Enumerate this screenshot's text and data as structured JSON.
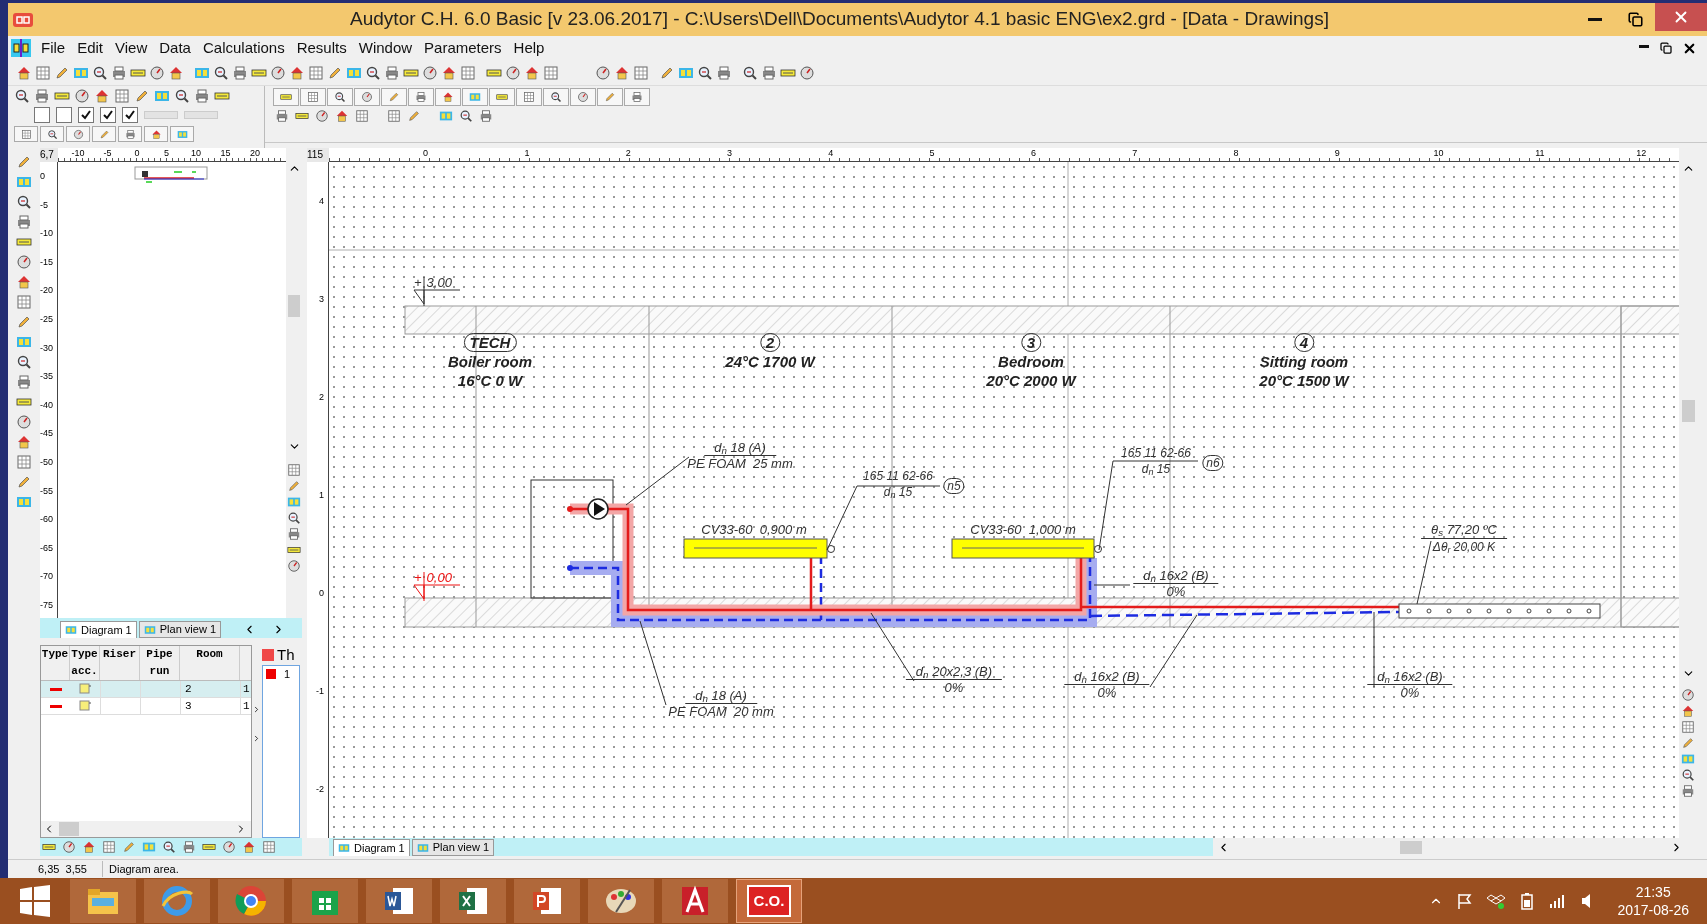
{
  "window": {
    "title": "Audytor C.H. 6.0 Basic [v 23.06.2017] - C:\\Users\\Dell\\Documents\\Audytor 4.1 basic ENG\\ex2.grd - [Data - Drawings]"
  },
  "menu": [
    "File",
    "Edit",
    "View",
    "Data",
    "Calculations",
    "Results",
    "Window",
    "Parameters",
    "Help"
  ],
  "toolbar_checkboxes": [
    {
      "checked": false
    },
    {
      "checked": false
    },
    {
      "checked": true
    },
    {
      "checked": true
    },
    {
      "checked": true
    }
  ],
  "overview": {
    "corner": "6,7",
    "x_ruler": [
      "-10",
      "-5",
      "0",
      "5",
      "10",
      "15",
      "20"
    ],
    "y_ruler": [
      "0",
      "-5",
      "-10",
      "-15",
      "-20",
      "-25",
      "-30",
      "-35",
      "-40",
      "-45",
      "-50",
      "-55",
      "-60",
      "-65",
      "-70",
      "-75"
    ],
    "tabs": [
      {
        "label": "Diagram 1",
        "selected": true
      },
      {
        "label": "Plan view 1",
        "selected": false
      }
    ]
  },
  "table": {
    "columns": [
      [
        "Type"
      ],
      [
        "Type",
        "acc."
      ],
      [
        "Riser"
      ],
      [
        "Pipe",
        "run"
      ],
      [
        "Room"
      ]
    ],
    "rows": [
      {
        "room": "2",
        "column_6": "1",
        "selected": true
      },
      {
        "room": "3",
        "column_6": "1",
        "selected": false
      }
    ],
    "legend": [
      "Th",
      "1"
    ]
  },
  "canvas": {
    "corner": "115",
    "x_ruler": [
      "0",
      "1",
      "2",
      "3",
      "4",
      "5",
      "6",
      "7",
      "8",
      "9",
      "10",
      "11",
      "12"
    ],
    "y_ruler": [
      "4",
      "3",
      "2",
      "1",
      "0",
      "-1",
      "-2"
    ],
    "levels": [
      {
        "sign": "+",
        "value": "3,00",
        "color": "#333333"
      },
      {
        "sign": "+",
        "value": "0,00",
        "color": "#ee1111"
      }
    ],
    "rooms": [
      {
        "tag": "TECH",
        "name": "Boiler room",
        "load": "16°C 0 W"
      },
      {
        "tag": "2",
        "load": "24°C 1700 W"
      },
      {
        "tag": "3",
        "name": "Bedroom",
        "load": "20°C 2000 W"
      },
      {
        "tag": "4",
        "name": "Sitting room",
        "load": "20°C 1500 W"
      }
    ],
    "radiators": [
      "CV33-60  0,900 m",
      "CV33-60  1,000 m"
    ],
    "valves": [
      {
        "code": "165 11 62-66",
        "size": "d$_{n}$ 15",
        "tag": "n5"
      },
      {
        "code": "165 11 62-66",
        "size": "d$_{n}$ 15",
        "tag": "n6"
      }
    ],
    "heater": {
      "supply": "θ$_{s}$ 77,20 ºC",
      "drop": "Δθ$_{r}$ 20,00 K"
    },
    "pipe_labels": [
      {
        "size": "d$_{n}$ 18 (A)",
        "note": "PE FOAM  25 mm"
      },
      {
        "size": "d$_{n}$ 16x2 (B)",
        "note": "0%"
      },
      {
        "size": "d$_{n}$ 20x2,3 (B)",
        "note": "0%"
      },
      {
        "size": "d$_{n}$ 16x2 (B)",
        "note": "0%"
      },
      {
        "size": "d$_{n}$ 16x2 (B)",
        "note": "0%"
      },
      {
        "size": "d$_{n}$ 18 (A)",
        "note": "PE FOAM  20 mm"
      }
    ],
    "tabs": [
      {
        "label": "Diagram 1",
        "selected": true
      },
      {
        "label": "Plan view 1",
        "selected": false
      }
    ]
  },
  "status_bar": {
    "coords": "6,35  3,55",
    "message": "Diagram area."
  },
  "taskbar": {
    "app_label": "C.O.",
    "time": "21:35",
    "date": "2017-08-26"
  }
}
